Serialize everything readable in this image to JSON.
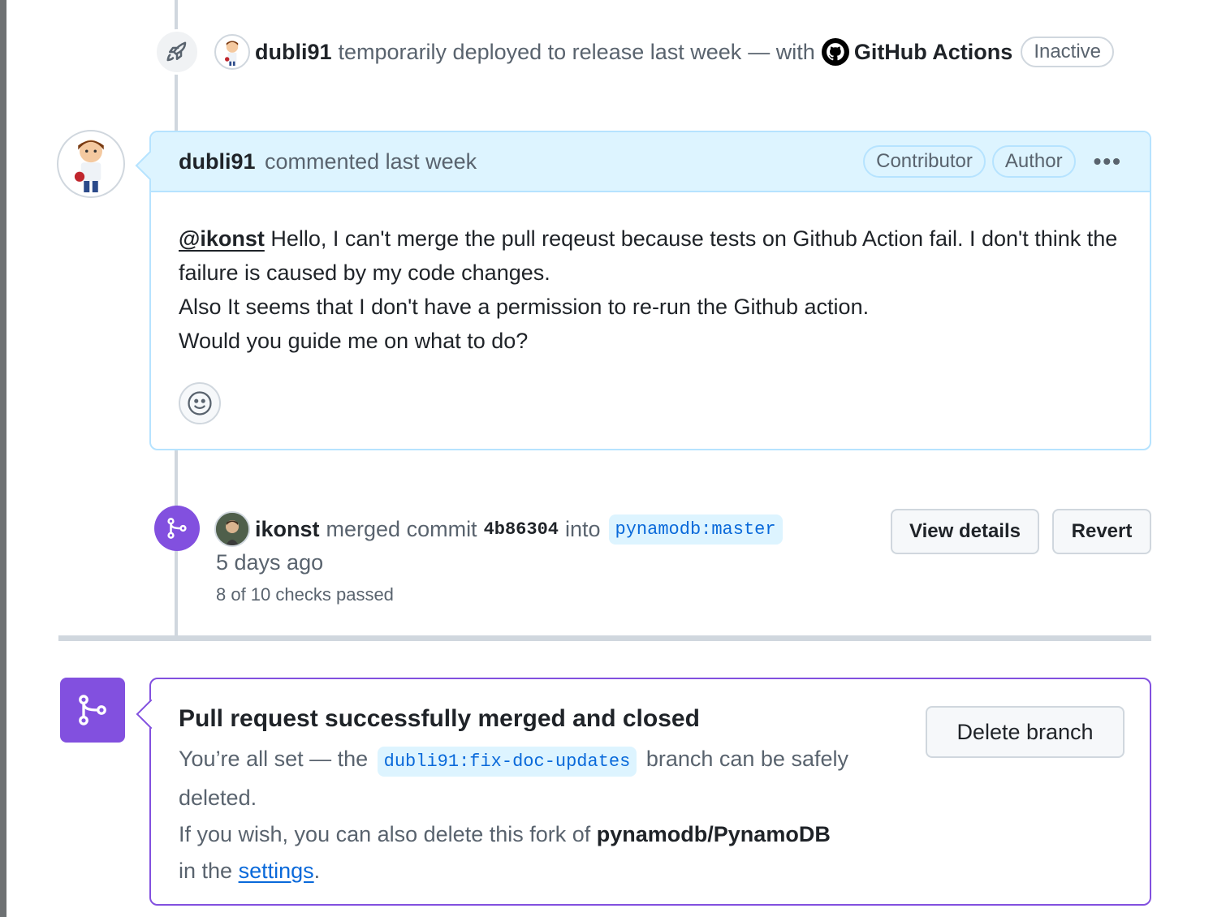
{
  "deploy_event": {
    "user": "dubli91",
    "action": "temporarily deployed to release last week",
    "separator": "— with",
    "actor": "GitHub Actions",
    "status": "Inactive"
  },
  "comment": {
    "author": "dubli91",
    "meta": "commented last week",
    "badges": [
      "Contributor",
      "Author"
    ],
    "mention": "@ikonst",
    "line1": " Hello, I can't merge the pull reqeust because tests on Github Action fail. I don't think the failure is caused by my code changes.",
    "line2": "Also It seems that I don't have a permission to re-run the Github action.",
    "line3": "Would you guide me on what to do?"
  },
  "merge_event": {
    "user": "ikonst",
    "action": "merged commit",
    "sha": "4b86304",
    "into": "into",
    "target_branch": "pynamodb:master",
    "time": "5 days ago",
    "checks": "8 of 10 checks passed",
    "view_details_label": "View details",
    "revert_label": "Revert"
  },
  "merged_box": {
    "title": "Pull request successfully merged and closed",
    "desc_prefix": "You’re all set — the",
    "branch": "dubli91:fix-doc-updates",
    "desc_suffix": "branch can be safely deleted.",
    "fork_prefix": "If you wish, you can also delete this fork of",
    "fork_repo": "pynamodb/PynamoDB",
    "settings_prefix": "in the",
    "settings_link": "settings",
    "settings_suffix": ".",
    "delete_label": "Delete branch"
  },
  "colors": {
    "merged_purple": "#8250df",
    "link_blue": "#0969da",
    "comment_header_bg": "#ddf4ff"
  }
}
